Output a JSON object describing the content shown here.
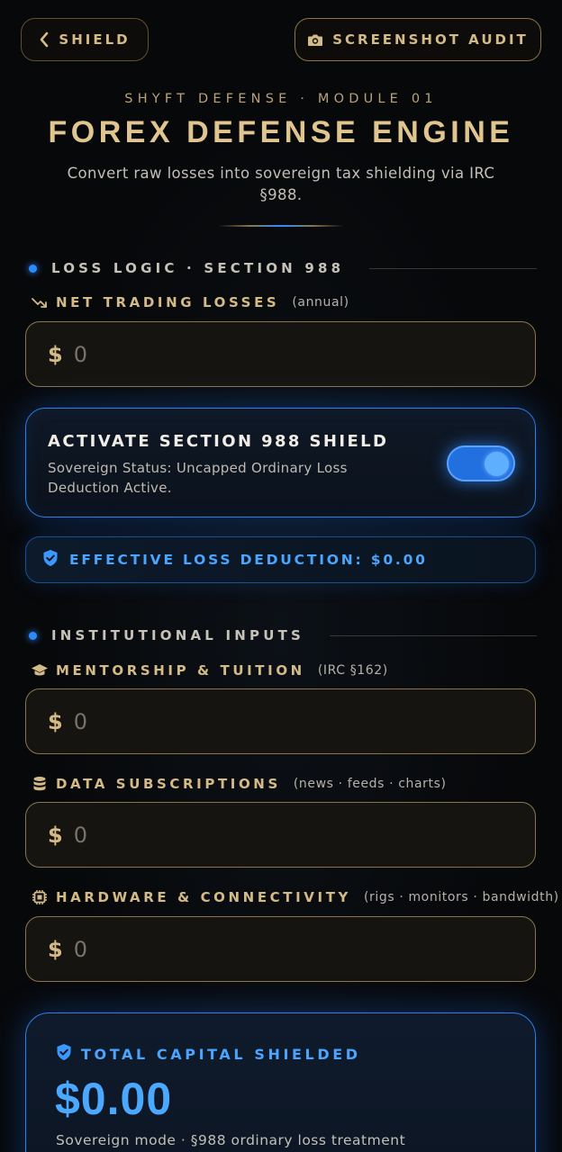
{
  "header": {
    "back_label": "SHIELD",
    "audit_label": "SCREENSHOT AUDIT",
    "back_icon": "chevron-left-icon",
    "audit_icon": "camera-icon"
  },
  "hero": {
    "eyebrow": "SHYFT DEFENSE · MODULE 01",
    "title": "FOREX DEFENSE ENGINE",
    "subtitle": "Convert raw losses into sovereign tax shielding via IRC §988."
  },
  "loss_section": {
    "title": "LOSS LOGIC · SECTION 988",
    "net_losses": {
      "label": "NET TRADING LOSSES",
      "hint": "(annual)",
      "currency": "$",
      "placeholder": "0",
      "icon": "trending-down-icon"
    },
    "shield": {
      "title": "ACTIVATE SECTION 988 SHIELD",
      "description": "Sovereign Status: Uncapped Ordinary Loss Deduction Active.",
      "enabled": true
    },
    "effective": {
      "text": "EFFECTIVE LOSS DEDUCTION: $0.00",
      "icon": "shield-check-icon"
    }
  },
  "institutional_section": {
    "title": "INSTITUTIONAL INPUTS",
    "fields": [
      {
        "label": "MENTORSHIP & TUITION",
        "hint": "(IRC §162)",
        "currency": "$",
        "placeholder": "0",
        "icon": "graduation-cap-icon"
      },
      {
        "label": "DATA SUBSCRIPTIONS",
        "hint": "(news · feeds · charts)",
        "currency": "$",
        "placeholder": "0",
        "icon": "database-icon"
      },
      {
        "label": "HARDWARE & CONNECTIVITY",
        "hint": "(rigs · monitors · bandwidth)",
        "currency": "$",
        "placeholder": "0",
        "icon": "chip-icon"
      }
    ]
  },
  "total": {
    "label": "TOTAL CAPITAL SHIELDED",
    "amount": "$0.00",
    "note": "Sovereign mode · §988 ordinary loss treatment",
    "icon": "shield-check-icon"
  },
  "colors": {
    "gold": "#d4ba86",
    "accent_blue": "#2e8bff",
    "background": "#07080a"
  }
}
